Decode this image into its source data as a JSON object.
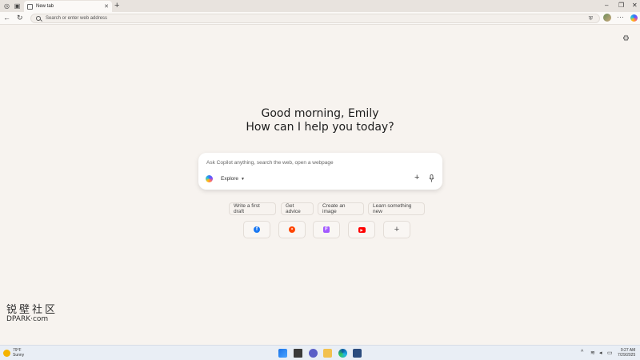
{
  "browser": {
    "tab_title": "New tab",
    "address_placeholder": "Search or enter web address"
  },
  "greeting": {
    "line1": "Good morning, Emily",
    "line2": "How can I help you today?"
  },
  "composer": {
    "placeholder": "Ask Copilot anything, search the web, open a webpage",
    "mode_label": "Explore"
  },
  "suggestions": [
    "Write a first draft",
    "Get advice",
    "Create an image",
    "Learn something new"
  ],
  "quick_links": [
    {
      "icon": "facebook-icon",
      "color": "#1877f2",
      "glyph": "f"
    },
    {
      "icon": "reddit-icon",
      "color": "#ff4500",
      "glyph": "•"
    },
    {
      "icon": "figma-icon",
      "color": "#a259ff",
      "glyph": "F"
    },
    {
      "icon": "youtube-icon",
      "color": "#ff0000",
      "glyph": "▶"
    }
  ],
  "watermark": {
    "cjk": "锐壁社区",
    "latin": "DPARK·com"
  },
  "taskbar": {
    "weather_temp": "79°F",
    "weather_desc": "Sunny",
    "time": "9:27 AM",
    "date": "7/29/2025"
  },
  "colors": {
    "page_bg": "#f7f3ef",
    "taskbar_bg": "#e9eef5"
  }
}
